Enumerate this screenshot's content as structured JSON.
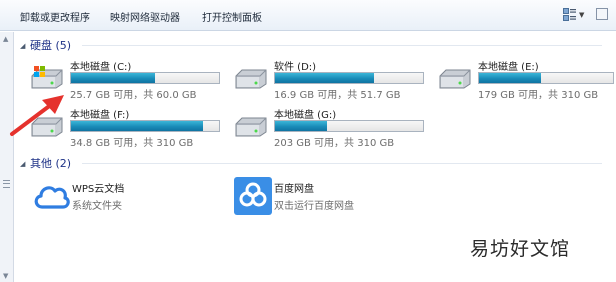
{
  "toolbar": {
    "uninstall_label": "卸载或更改程序",
    "map_drive_label": "映射网络驱动器",
    "control_panel_label": "打开控制面板"
  },
  "sections": {
    "drives_header": "硬盘 (5)",
    "other_header": "其他 (2)"
  },
  "drives": [
    {
      "name": "本地磁盘 (C:)",
      "space": "25.7 GB 可用，共 60.0 GB",
      "used_fraction": 0.57
    },
    {
      "name": "软件 (D:)",
      "space": "16.9 GB 可用，共 51.7 GB",
      "used_fraction": 0.67
    },
    {
      "name": "本地磁盘 (E:)",
      "space": "179 GB 可用，共 310 GB",
      "used_fraction": 0.42
    },
    {
      "name": "本地磁盘 (F:)",
      "space": "34.8 GB 可用，共 310 GB",
      "used_fraction": 0.89
    },
    {
      "name": "本地磁盘 (G:)",
      "space": "203 GB 可用，共 310 GB",
      "used_fraction": 0.35
    }
  ],
  "other": [
    {
      "name": "WPS云文档",
      "desc": "系统文件夹",
      "icon": "wps-cloud-icon"
    },
    {
      "name": "百度网盘",
      "desc": "双击运行百度网盘",
      "icon": "baidu-netdisk-icon"
    }
  ],
  "watermark": "易坊好文馆",
  "colors": {
    "bar_fill": "#1a8cb8",
    "section_header": "#1e3287",
    "arrow": "#e5322d",
    "wps_cloud": "#2f7de1",
    "baidu": "#3a8ee6"
  }
}
